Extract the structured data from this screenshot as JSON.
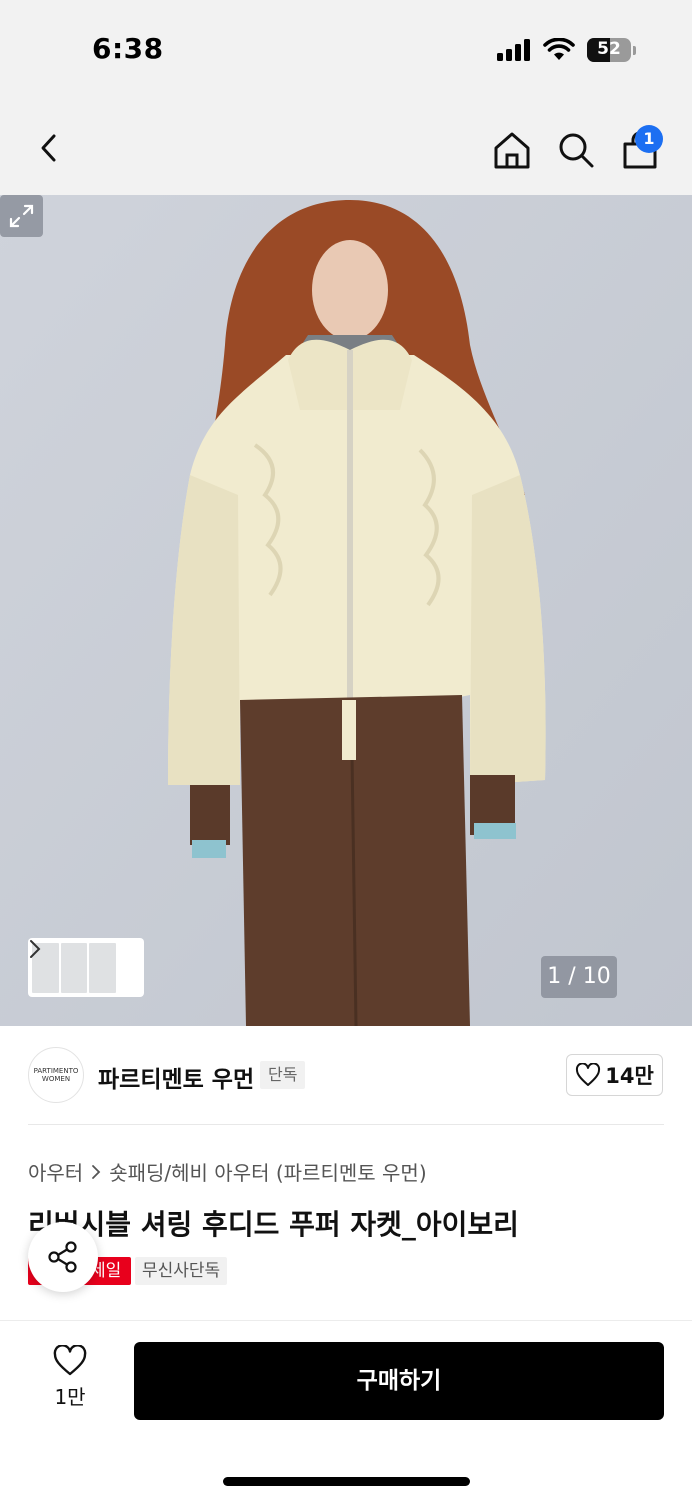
{
  "status_bar": {
    "time": "6:38",
    "battery_percent": "52",
    "battery_level": 0.52
  },
  "nav": {
    "cart_count": "1"
  },
  "gallery": {
    "counter": "1 / 10"
  },
  "brand": {
    "logo_line1": "PARTIMENTO",
    "logo_line2": "WOMEN",
    "name": "파르티멘토 우먼",
    "badge": "단독",
    "like_count": "14만"
  },
  "product": {
    "category_1": "아우터",
    "category_2": "숏패딩/헤비 아우터 (파르티멘토 우먼)",
    "title": "리버시블 셔링 후디드 푸퍼 자켓_아이보리",
    "tag_sale": "세일",
    "tag_exclusive": "무신사단독"
  },
  "bottom_bar": {
    "wish_count": "1만",
    "buy_label": "구매하기"
  },
  "colors": {
    "accent_blue": "#1c6ff2",
    "sale_red": "#e8001c",
    "buy_black": "#000000"
  }
}
